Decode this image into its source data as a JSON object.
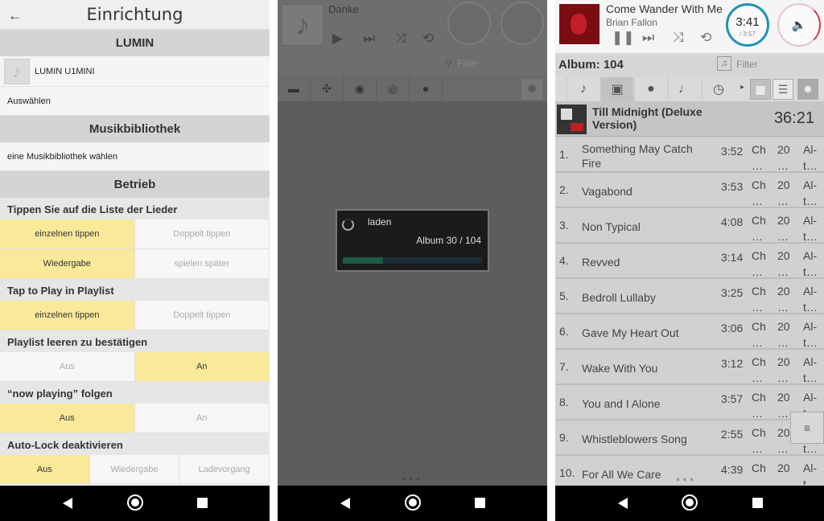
{
  "settings": {
    "title": "Einrichtung",
    "back_glyph": "←",
    "sections": {
      "lumin": "LUMIN",
      "library": "Musikbibliothek",
      "operation": "Betrieb"
    },
    "device_name": "LUMIN U1MINI",
    "select_label": "Auswählen",
    "library_choose": "eine Musikbibliothek wählen",
    "groups": [
      {
        "label": "Tippen Sie auf die Liste der Lieder",
        "rows": [
          [
            "einzelnen tippen",
            "Doppelt tippen"
          ],
          [
            "Wiedergabe",
            "spielen später"
          ]
        ]
      },
      {
        "label": "Tap to Play in Playlist",
        "rows": [
          [
            "einzelnen tippen",
            "Doppelt tippen"
          ]
        ]
      },
      {
        "label": "Playlist leeren zu bestätigen",
        "rows": [
          [
            "Aus",
            "An"
          ]
        ]
      },
      {
        "label": "“now playing” folgen",
        "rows": [
          [
            "Aus",
            "An"
          ]
        ]
      },
      {
        "label": "Auto-Lock deaktivieren",
        "rows": [
          [
            "Aus",
            "Wiedergabe",
            "Ladevorgang"
          ]
        ]
      }
    ]
  },
  "loading": {
    "song": "Danke",
    "filter_placeholder": "Filter",
    "dialog_title": "laden",
    "dialog_progress_text": "Album 30 / 104",
    "progress_fraction": 0.29,
    "page_dots": "●●●"
  },
  "album": {
    "now_playing": {
      "song": "Come Wander With Me",
      "artist": "Brian Fallon",
      "elapsed": "3:41",
      "total": "/ 3:57"
    },
    "album_count_label": "Album: 104",
    "filter_placeholder": "Filter",
    "album_title": "Till Midnight (Deluxe Version)",
    "album_duration": "36:21",
    "tracks": [
      {
        "n": "1.",
        "title": "Something May Catch Fire",
        "dur": "3:52"
      },
      {
        "n": "2.",
        "title": "Vagabond",
        "dur": "3:53"
      },
      {
        "n": "3.",
        "title": "Non Typical",
        "dur": "4:08"
      },
      {
        "n": "4.",
        "title": "Revved",
        "dur": "3:14"
      },
      {
        "n": "5.",
        "title": "Bedroll Lullaby",
        "dur": "3:25"
      },
      {
        "n": "6.",
        "title": "Gave My Heart Out",
        "dur": "3:06"
      },
      {
        "n": "7.",
        "title": "Wake With You",
        "dur": "3:12"
      },
      {
        "n": "8.",
        "title": "You and I Alone",
        "dur": "3:57"
      },
      {
        "n": "9.",
        "title": "Whistleblowers Song",
        "dur": "2:55"
      },
      {
        "n": "10.",
        "title": "For All We Care",
        "dur": "4:39"
      }
    ],
    "col1": "Ch\n…",
    "col2": "20\n…",
    "col3": "Al-\nt…",
    "page_dots": "●●●"
  },
  "accent_colors": {
    "selected": "#fbe99a",
    "time_ring": "#1e93b2",
    "volume": "#d23b48"
  }
}
